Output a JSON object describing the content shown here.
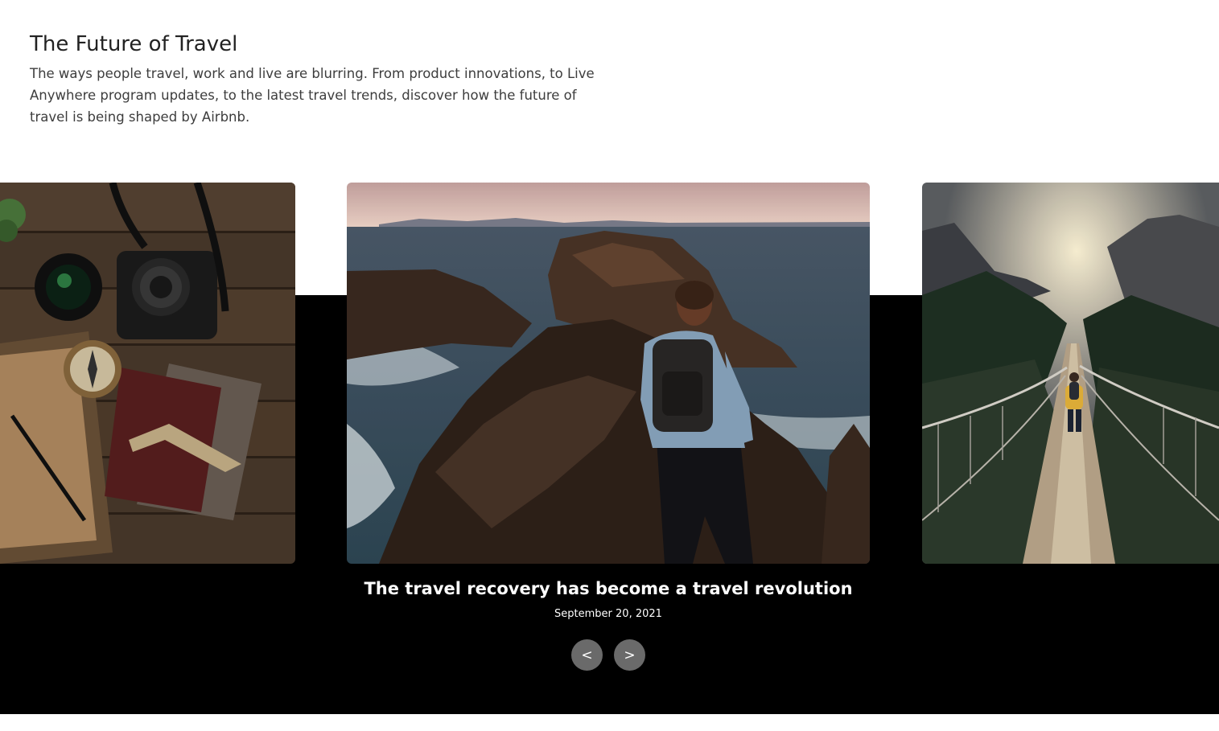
{
  "intro": {
    "title": "The Future of Travel",
    "description": "The ways people travel, work and live are blurring. From product innovations, to Live Anywhere program updates, to the latest travel trends, discover how the future of travel is being shaped by Airbnb."
  },
  "carousel": {
    "active_article": {
      "title": "The travel recovery has become a travel revolution",
      "date": "September 20, 2021"
    },
    "prev_label": "<",
    "next_label": ">"
  },
  "colors": {
    "band": "#000000",
    "nav_button": "#6a6a6a",
    "heading": "#222222",
    "body_text": "#3d3d3d"
  },
  "icons": {
    "prev": "chevron-left",
    "next": "chevron-right"
  }
}
